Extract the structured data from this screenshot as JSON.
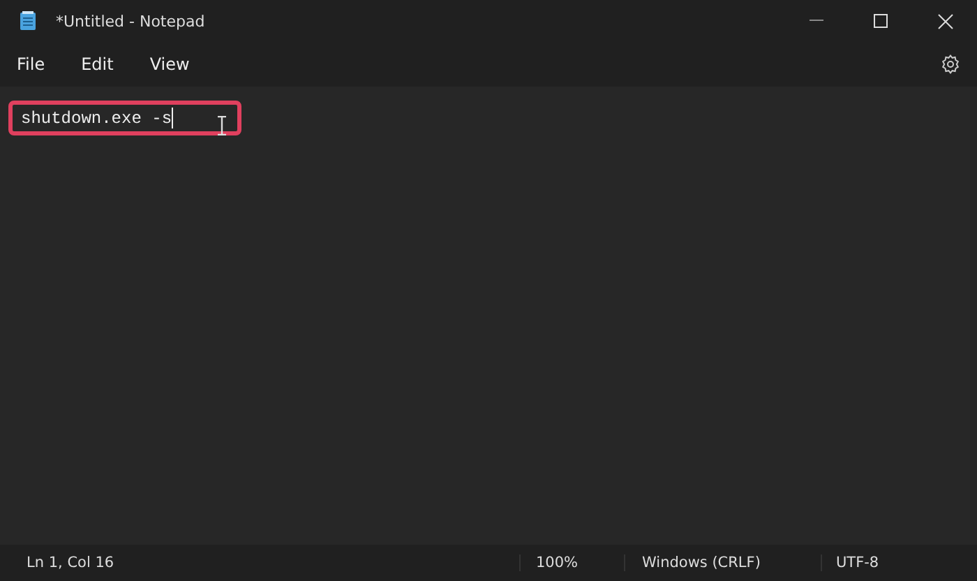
{
  "window": {
    "title": "*Untitled - Notepad"
  },
  "menu": [
    {
      "label": "File"
    },
    {
      "label": "Edit"
    },
    {
      "label": "View"
    }
  ],
  "editor": {
    "text": "shutdown.exe -s",
    "highlighted": true
  },
  "status_bar": [
    {
      "text": "Ln 1, Col 16"
    },
    {
      "text": "100%"
    },
    {
      "text": "Windows (CRLF)"
    },
    {
      "text": "UTF-8"
    }
  ]
}
